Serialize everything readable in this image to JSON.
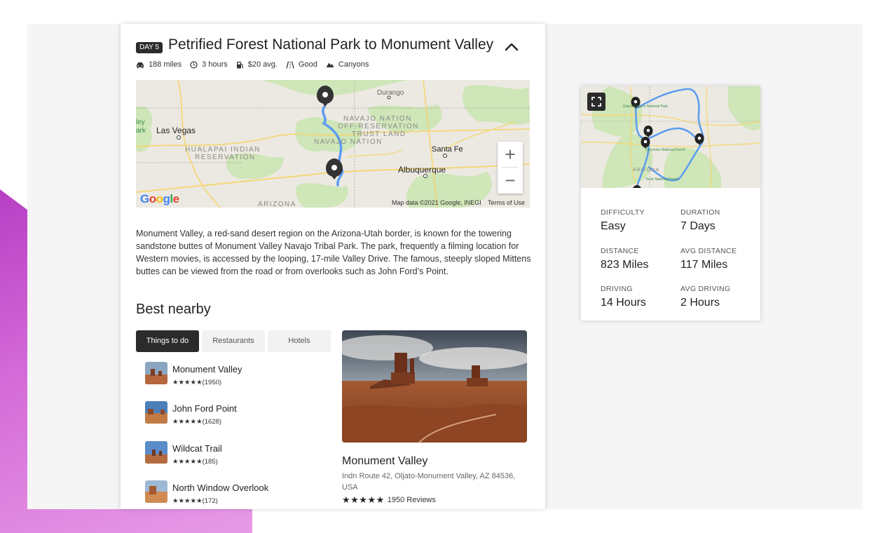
{
  "day": {
    "badge": "DAY 5",
    "title": "Petrified Forest National Park to Monument Valley",
    "meta": [
      {
        "icon": "car-icon",
        "text": "188 miles"
      },
      {
        "icon": "clock-icon",
        "text": "3 hours"
      },
      {
        "icon": "gas-pump-icon",
        "text": "$20 avg."
      },
      {
        "icon": "road-icon",
        "text": "Good"
      },
      {
        "icon": "mountain-icon",
        "text": "Canyons"
      }
    ]
  },
  "map": {
    "labels": {
      "durango": "Durango",
      "navajo_nation": "NAVAJO NATION",
      "off_reservation": "OFF-RESERVATION",
      "trust_land": "TRUST LAND",
      "navajo_nation_2": "NAVAJO NATION",
      "las_vegas": "Las Vegas",
      "valley_park_1": "ley",
      "valley_park_2": "ark",
      "hualapai_1": "HUALAPAI INDIAN",
      "hualapai_2": "RESERVATION",
      "santa_fe": "Santa Fe",
      "albuquerque": "Albuquerque",
      "arizona": "ARIZONA"
    },
    "zoom_in": "+",
    "zoom_out": "−",
    "attribution": "Map data ©2021 Google, INEGI",
    "terms": "Terms of Use",
    "logo": "Google"
  },
  "description": "Monument Valley, a red-sand desert region on the Arizona-Utah border, is known for the towering sandstone buttes of Monument Valley Navajo Tribal Park. The park, frequently a filming location for Western movies, is accessed by the looping, 17-mile Valley Drive. The famous, steeply sloped Mittens buttes can be viewed from the road or from overlooks such as John Ford’s Point.",
  "nearby": {
    "title": "Best nearby",
    "tabs": [
      "Things to do",
      "Restaurants",
      "Hotels"
    ],
    "places": [
      {
        "name": "Monument Valley",
        "rating": "★★★★★(1950)"
      },
      {
        "name": "John Ford Point",
        "rating": "★★★★★(1628)"
      },
      {
        "name": "Wildcat Trail",
        "rating": "★★★★★(185)"
      },
      {
        "name": "North Window Overlook",
        "rating": "★★★★★(172)"
      }
    ],
    "featured": {
      "name": "Monument Valley",
      "address": "Indn Route 42, Oljato-Monument Valley, AZ 84536, USA",
      "stars": "★★★★★",
      "reviews": "1950 Reviews"
    }
  },
  "overview": {
    "map_labels": {
      "grand_canyon": "Grand Canyon National Park",
      "coconino": "Coconino National Forest",
      "arizona": "ARIZONA",
      "tonto": "Tonto National Forest"
    },
    "stats": [
      {
        "label": "DIFFICULTY",
        "value": "Easy"
      },
      {
        "label": "DURATION",
        "value": "7 Days"
      },
      {
        "label": "DISTANCE",
        "value": "823 Miles"
      },
      {
        "label": "AVG DISTANCE",
        "value": "117 Miles"
      },
      {
        "label": "DRIVING",
        "value": "14 Hours"
      },
      {
        "label": "AVG DRIVING",
        "value": "2 Hours"
      }
    ]
  },
  "colors": {
    "accent_dark": "#2b2b2b",
    "route_blue": "#4a90e2",
    "map_green": "#cfe6b8",
    "map_desert": "#ece9e2",
    "background_purple": "#c558cc"
  }
}
